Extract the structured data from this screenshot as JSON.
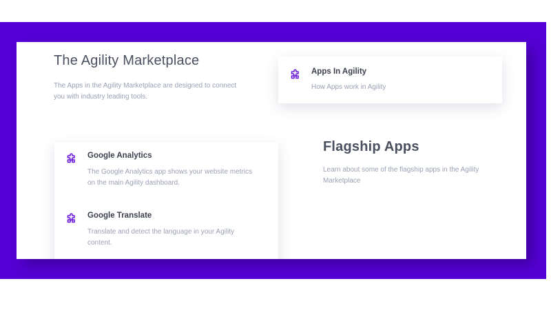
{
  "marketplace": {
    "title": "The Agility Marketplace",
    "description": "The Apps in the Agility Marketplace are designed to connect you with industry leading tools."
  },
  "featured_app": {
    "name": "Apps In Agility",
    "description": "How Apps work in Agility",
    "icon": "puzzle-icon"
  },
  "apps": [
    {
      "name": "Google Analytics",
      "description": "The Google Analytics app shows your website metrics on the main Agility dashboard.",
      "icon": "puzzle-icon"
    },
    {
      "name": "Google Translate",
      "description": "Translate and detect the language in your Agility content.",
      "icon": "puzzle-icon"
    }
  ],
  "flagship": {
    "title": "Flagship Apps",
    "description": "Learn about some of the flagship apps in the Agility Marketplace"
  },
  "colors": {
    "accent": "#5500d6",
    "heading": "#4b5060",
    "body_text": "#9aa0b4"
  }
}
